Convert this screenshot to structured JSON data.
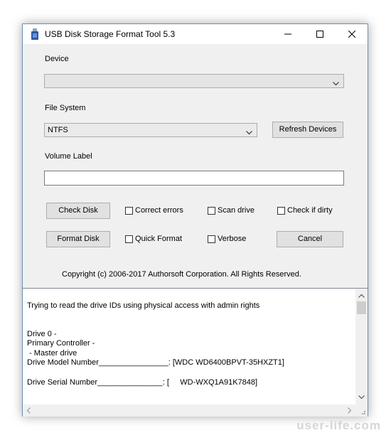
{
  "window": {
    "title": "USB Disk Storage Format Tool 5.3",
    "controls": {
      "minimize_icon": "minimize-icon",
      "maximize_icon": "maximize-icon",
      "close_icon": "close-icon"
    }
  },
  "device": {
    "label": "Device",
    "value": ""
  },
  "file_system": {
    "label": "File System",
    "value": "NTFS"
  },
  "refresh_button": "Refresh Devices",
  "volume_label": {
    "label": "Volume Label",
    "value": ""
  },
  "check_disk_button": "Check Disk",
  "format_disk_button": "Format Disk",
  "cancel_button": "Cancel",
  "options": {
    "correct_errors": {
      "label": "Correct errors",
      "checked": false
    },
    "scan_drive": {
      "label": "Scan drive",
      "checked": false
    },
    "check_if_dirty": {
      "label": "Check if dirty",
      "checked": false
    },
    "quick_format": {
      "label": "Quick Format",
      "checked": false
    },
    "verbose": {
      "label": "Verbose",
      "checked": false
    }
  },
  "copyright": "Copyright (c) 2006-2017 Authorsoft Corporation. All Rights Reserved.",
  "log": {
    "lines": [
      "Trying to read the drive IDs using physical access with admin rights",
      "Drive 0 -",
      "Primary Controller -",
      " - Master drive",
      "Drive Model Number________________: [WDC WD6400BPVT-35HXZT1]",
      "Drive Serial Number_______________: [     WD-WXQ1A91K7848]"
    ]
  },
  "watermark": "user-life.com",
  "colors": {
    "window_bg": "#f0f0f0",
    "border": "#6f8fb5",
    "button_bg": "#e1e1e1"
  }
}
